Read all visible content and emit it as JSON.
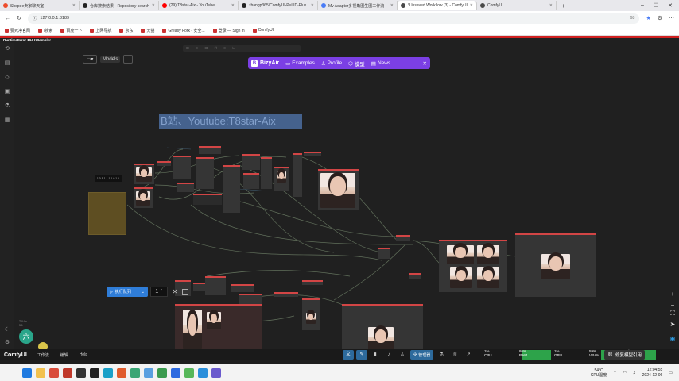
{
  "browser": {
    "tabs": [
      {
        "title": "Shopee卖家聊天室",
        "active": false,
        "color": "#ee4d2d"
      },
      {
        "title": "仓库搜索结果 · Repository search",
        "active": false,
        "color": "#222222"
      },
      {
        "title": "(29) T8star-Aix - YouTube",
        "active": false,
        "color": "#ff0000"
      },
      {
        "title": "zhangp365/ComfyUI-PuLID-Flux",
        "active": false,
        "color": "#222222"
      },
      {
        "title": "Mv Adapter多视角图生图工作流",
        "active": false,
        "color": "#4a7cf6"
      },
      {
        "title": "*Unsaved Workflow (3) - ComfyUI",
        "active": true,
        "color": "#4a4a4a"
      },
      {
        "title": "ComfyUI",
        "active": false,
        "color": "#4a4a4a"
      }
    ],
    "url": "127.0.0.1:8189",
    "zoom_indicator": "68",
    "bookmarks": [
      "要死净官网",
      "/搜索",
      "百度一下",
      "上网导航",
      "京东",
      "天猫",
      "Greasy Fork - 安全...",
      "登录 — Sign in",
      "ComfyUI"
    ]
  },
  "app": {
    "error_label": "RuntimeError 164 KSampler",
    "toolbar": {
      "models_label": "Models"
    },
    "bizyair": {
      "brand": "BizyAir",
      "items": [
        "Examples",
        "Profile",
        "模型",
        "News"
      ]
    },
    "watermark_text": "B站、Youtube:T8star-Aix",
    "node_label": "1 0.5 1 1.1 1.0 1 1",
    "run_button_label": "执行队列",
    "batch_count": "1",
    "stats": [
      "T 0.0s",
      "5.1"
    ],
    "badge_char": "六"
  },
  "appbar": {
    "brand": "ComfyUI",
    "menu": [
      "工作流",
      "编辑",
      "Help"
    ],
    "queue_label": "管理器",
    "meters": [
      {
        "name": "CPU",
        "pct": "1%",
        "fill": 0.01
      },
      {
        "name": "RAM",
        "pct": "86%",
        "fill": 0.86
      },
      {
        "name": "GPU",
        "pct": "1%",
        "fill": 0.01
      },
      {
        "name": "VRAM",
        "pct": "59%",
        "fill": 0.59
      },
      {
        "name": "Temp",
        "pct": "38°",
        "fill": 0.38
      }
    ],
    "model_link_label": "修复模型引用"
  },
  "taskbar": {
    "weather_temp": "54°C",
    "weather_label": "CPU温度",
    "time": "12:04:55",
    "date": "2024-12-06"
  }
}
